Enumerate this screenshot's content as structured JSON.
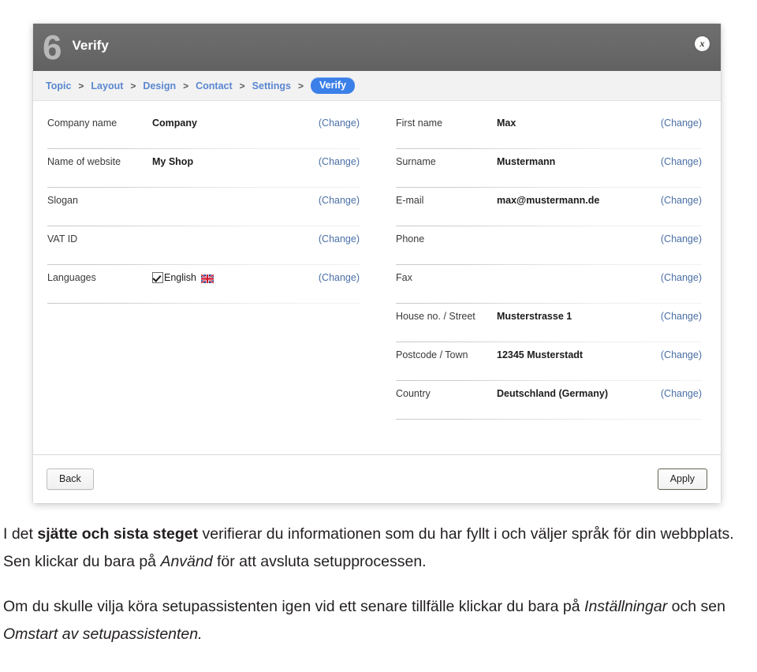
{
  "dialog": {
    "step_number": "6",
    "title": "Verify",
    "close_label": "x",
    "breadcrumb": {
      "separator": ">",
      "items": [
        {
          "label": "Topic",
          "active": false
        },
        {
          "label": "Layout",
          "active": false
        },
        {
          "label": "Design",
          "active": false
        },
        {
          "label": "Contact",
          "active": false
        },
        {
          "label": "Settings",
          "active": false
        },
        {
          "label": "Verify",
          "active": true
        }
      ]
    },
    "left_column": [
      {
        "label": "Company name",
        "value": "Company",
        "change": "(Change)"
      },
      {
        "label": "Name of website",
        "value": "My Shop",
        "change": "(Change)"
      },
      {
        "label": "Slogan",
        "value": "",
        "change": "(Change)"
      },
      {
        "label": "VAT ID",
        "value": "",
        "change": "(Change)"
      },
      {
        "label": "Languages",
        "value": "",
        "change": "(Change)",
        "language": {
          "name": "English",
          "checked": true,
          "flag": "uk-flag-icon"
        }
      }
    ],
    "right_column": [
      {
        "label": "First name",
        "value": "Max",
        "change": "(Change)"
      },
      {
        "label": "Surname",
        "value": "Mustermann",
        "change": "(Change)"
      },
      {
        "label": "E-mail",
        "value": "max@mustermann.de",
        "change": "(Change)"
      },
      {
        "label": "Phone",
        "value": "",
        "change": "(Change)"
      },
      {
        "label": "Fax",
        "value": "",
        "change": "(Change)"
      },
      {
        "label": "House no. / Street",
        "value": "Musterstrasse 1",
        "change": "(Change)"
      },
      {
        "label": "Postcode / Town",
        "value": "12345 Musterstadt",
        "change": "(Change)"
      },
      {
        "label": "Country",
        "value": "Deutschland (Germany)",
        "change": "(Change)"
      }
    ],
    "footer": {
      "back_label": "Back",
      "apply_label": "Apply"
    }
  },
  "caption": {
    "p1_a": "I det ",
    "p1_bold": "sjätte och sista steget",
    "p1_b": " verifierar du informationen som du har fyllt i och väljer språk för din webbplats. Sen klickar du bara på ",
    "p1_italic": "Använd",
    "p1_c": " för att avsluta setupprocessen.",
    "p2_a": "Om du skulle vilja köra setupassistenten igen vid ett senare tillfälle klickar du bara på ",
    "p2_italic1": "Inställningar",
    "p2_b": " och sen ",
    "p2_italic2": "Omstart av setupassistenten.",
    "p2_c": ""
  },
  "colors": {
    "header_grey": "#696969",
    "breadcrumb_bg": "#f2f2f2",
    "link_blue": "#5b87d0",
    "active_pill_blue": "#3b7fe8",
    "change_link_blue": "#4a6fa5",
    "step_number_grey": "#b9b9b9"
  }
}
